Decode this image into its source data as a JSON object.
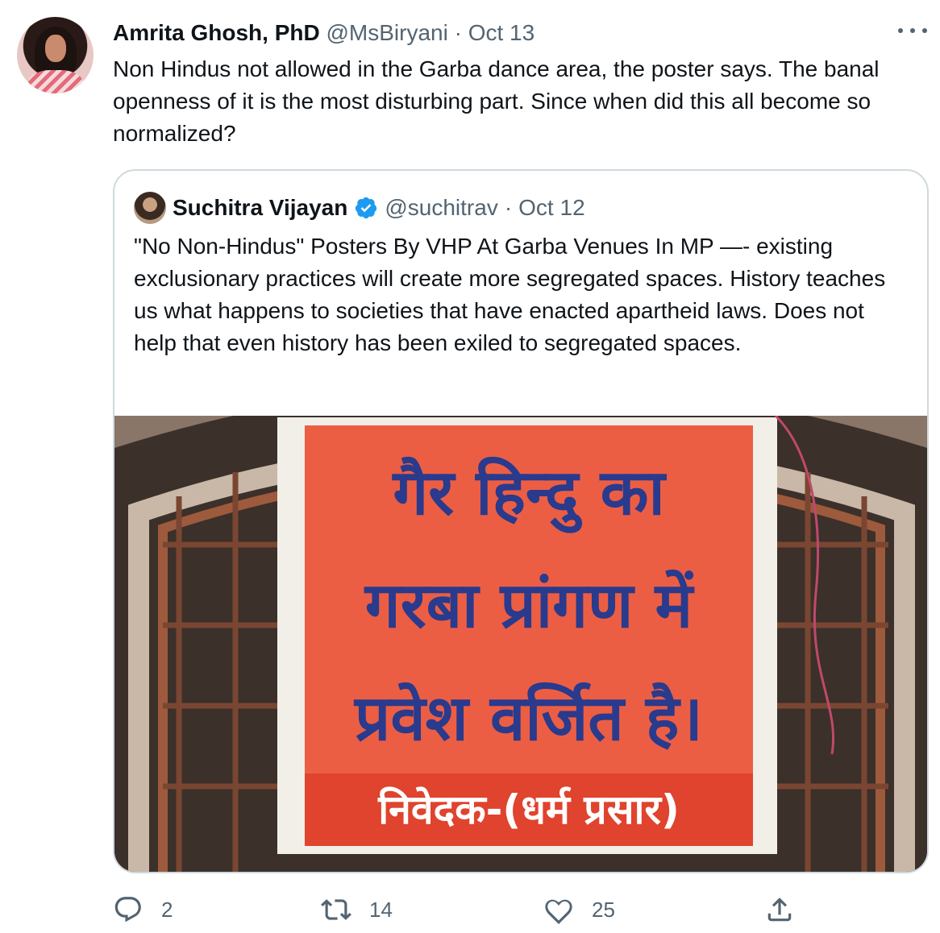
{
  "tweet": {
    "author_name": "Amrita Ghosh, PhD",
    "author_handle": "@MsBiryani",
    "separator": "·",
    "date": "Oct 13",
    "text": "Non Hindus not allowed in the Garba dance area, the poster says. The banal openness of it is the most disturbing part. Since when did this all become so normalized?",
    "more_icon": "more-horizontal-icon"
  },
  "quoted_tweet": {
    "author_name": "Suchitra Vijayan",
    "verified": true,
    "author_handle": "@suchitrav",
    "separator": "·",
    "date": "Oct 12",
    "text": "\"No Non-Hindus\" Posters By VHP At Garba Venues In MP —- existing exclusionary practices will create more segregated spaces. History teaches us what happens to societies that have enacted apartheid laws. Does not help that even history has been exiled to segregated spaces.",
    "media": {
      "poster_lines": [
        "गैर हिन्दु का",
        "गरबा प्रांगण में",
        "प्रवेश वर्जित है।"
      ],
      "poster_footer": "निवेदक-(धर्म प्रसार)"
    }
  },
  "actions": {
    "reply_count": "2",
    "retweet_count": "14",
    "like_count": "25"
  },
  "colors": {
    "text": "#0f1419",
    "muted": "#536471",
    "border": "#cfd9de",
    "verified": "#1d9bf0",
    "poster_bg": "#ec5e44",
    "poster_text": "#2a3a8c"
  }
}
